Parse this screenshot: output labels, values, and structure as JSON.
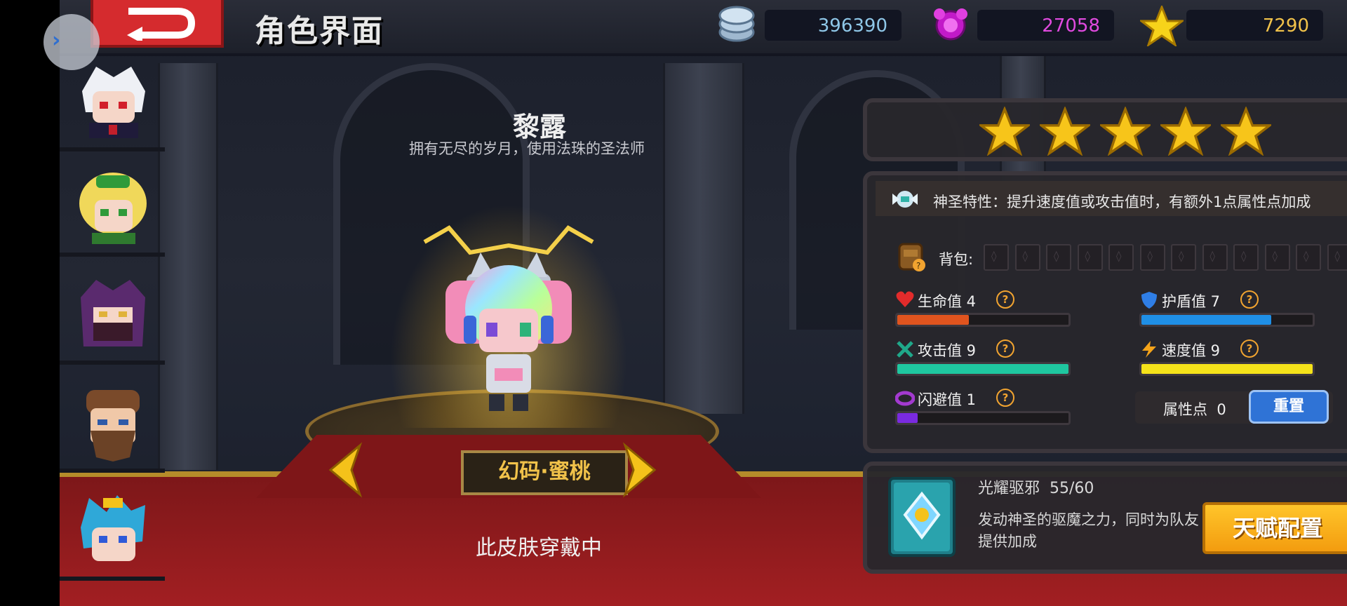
{
  "header": {
    "title": "角色界面",
    "resources": [
      {
        "name": "coins",
        "icon": "silver-coins-icon",
        "value": "396390",
        "color": "#8fc7e8"
      },
      {
        "name": "gems",
        "icon": "purple-gem-icon",
        "value": "27058",
        "color": "#e14ae0"
      },
      {
        "name": "stars",
        "icon": "gold-star-icon",
        "value": "7290",
        "color": "#f1c24a"
      }
    ]
  },
  "roster": {
    "heroes": [
      {
        "name": "white-hair-vampire"
      },
      {
        "name": "green-elf-archer"
      },
      {
        "name": "purple-hood-ninja"
      },
      {
        "name": "bearded-warrior"
      },
      {
        "name": "blue-dragon-hero"
      }
    ]
  },
  "character": {
    "name": "黎露",
    "description": "拥有无尽的岁月，使用法珠的圣法师",
    "skin_name": "幻码·蜜桃",
    "skin_status": "此皮肤穿戴中"
  },
  "rating": {
    "stars": 5,
    "max_stars": 5
  },
  "trait": {
    "text": "神圣特性：提升速度值或攻击值时，有额外1点属性点加成"
  },
  "bag": {
    "label": "背包:",
    "slots": 13
  },
  "stats": [
    {
      "label": "生命值 4",
      "value": 4,
      "max": 20,
      "fill": 0.42,
      "color": "#e0541e",
      "icon": "heart-icon",
      "icon_color": "#e22b2b"
    },
    {
      "label": "护盾值 7",
      "value": 7,
      "max": 20,
      "fill": 0.76,
      "color": "#1f8fe6",
      "icon": "shield-icon",
      "icon_color": "#2f7ee6"
    },
    {
      "label": "攻击值 9",
      "value": 9,
      "max": 9,
      "fill": 1.0,
      "color": "#1fc7a0",
      "icon": "sword-icon",
      "icon_color": "#1fa88a"
    },
    {
      "label": "速度值 9",
      "value": 9,
      "max": 9,
      "fill": 1.0,
      "color": "#f5e21a",
      "icon": "lightning-icon",
      "icon_color": "#f5a41a"
    },
    {
      "label": "闪避值 1",
      "value": 1,
      "max": 20,
      "fill": 0.12,
      "color": "#7a2ae0",
      "icon": "dodge-icon",
      "icon_color": "#a33ad0"
    }
  ],
  "points": {
    "label": "属性点",
    "value": "0",
    "reset_label": "重置"
  },
  "skill": {
    "name": "光耀驱邪",
    "progress": "55/60",
    "description": "发动神圣的驱魔之力，同时为队友提供加成",
    "talent_button": "天赋配置"
  }
}
